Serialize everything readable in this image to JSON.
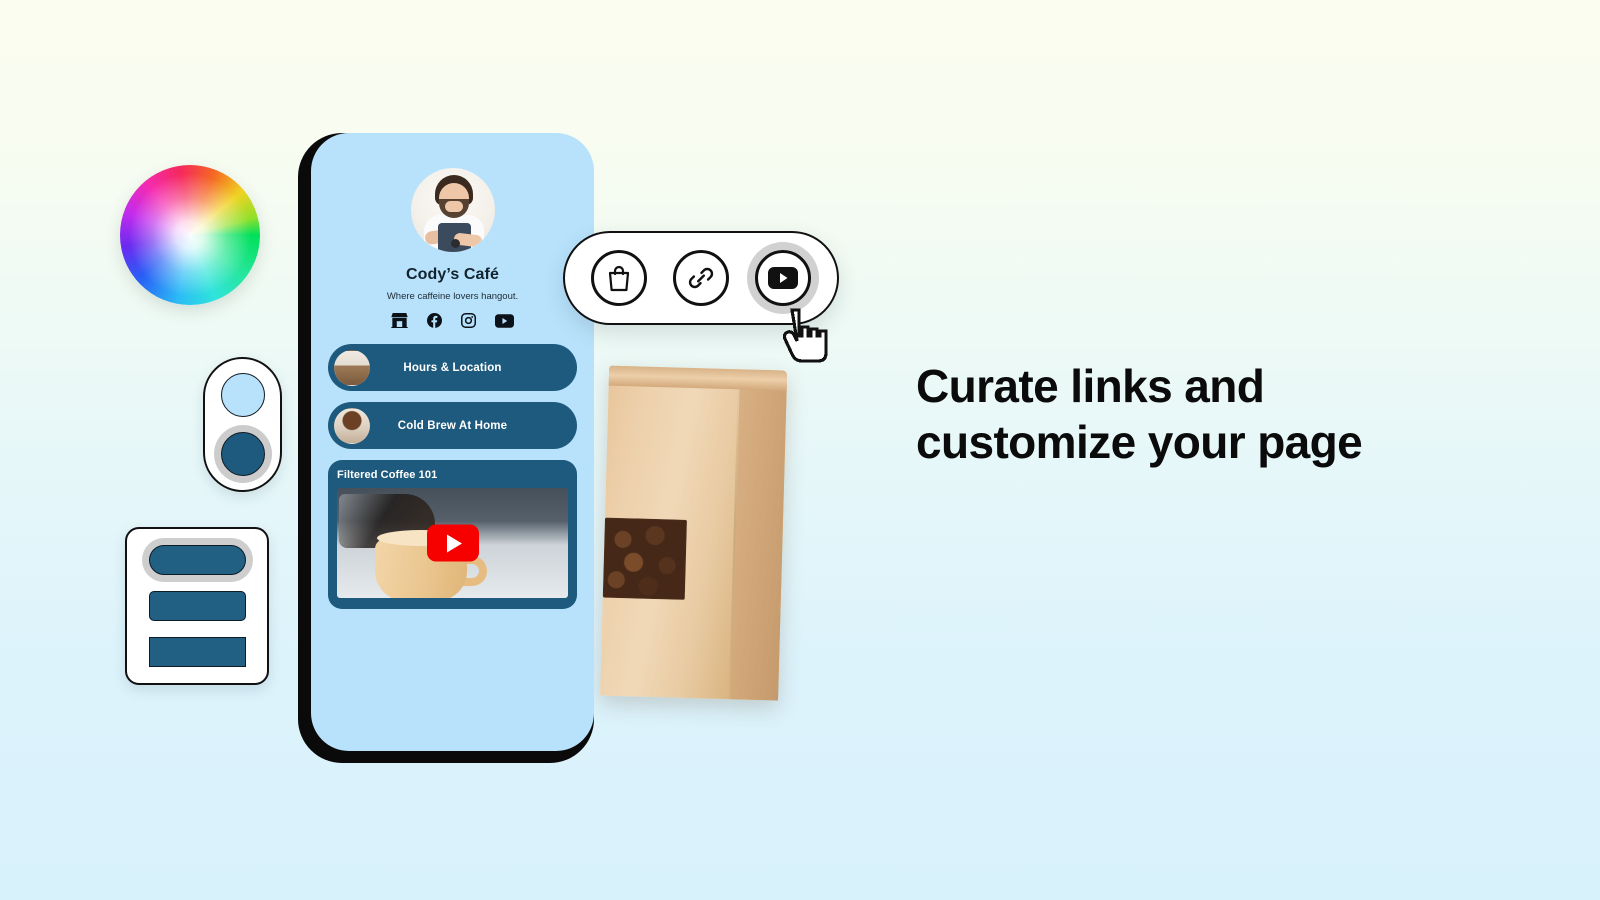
{
  "background": {
    "top_color": "#fbfdf0",
    "mid_color": "#eefaf5",
    "bottom_color": "#d8f2fc"
  },
  "headline": {
    "line1": "Curate links and",
    "line2": "customize your page",
    "color": "#0b0b0b"
  },
  "phone": {
    "screen_color": "#b8e2fb",
    "frame_color": "#0a0a0a",
    "profile": {
      "name": "Cody’s Café",
      "tagline": "Where caffeine lovers hangout.",
      "avatar_alt": "barista-portrait"
    },
    "social_icons": [
      {
        "name": "storefront-icon"
      },
      {
        "name": "facebook-icon"
      },
      {
        "name": "instagram-icon"
      },
      {
        "name": "youtube-icon"
      }
    ],
    "links": [
      {
        "label": "Hours & Location",
        "thumb": "cafe-interior-thumbnail"
      },
      {
        "label": "Cold Brew At Home",
        "thumb": "coffee-brewer-thumbnail"
      }
    ],
    "video_card": {
      "title": "Filtered Coffee 101",
      "thumbnail_alt": "pour-over-coffee-into-mug",
      "play_button": "youtube-play-button",
      "play_color": "#f60000"
    },
    "card_color": "#1e5a7d"
  },
  "icon_toolbar": {
    "icons": [
      {
        "name": "shopping-bag-icon",
        "selected": false
      },
      {
        "name": "link-chain-icon",
        "selected": false
      },
      {
        "name": "youtube-icon",
        "selected": true
      }
    ],
    "cursor": "pointing-hand-cursor"
  },
  "color_wheel": {
    "name": "color-wheel-picker"
  },
  "color_swatch_picker": {
    "swatches": [
      {
        "name": "light-blue-swatch",
        "color": "#b8e2fb",
        "selected": false
      },
      {
        "name": "dark-blue-swatch",
        "color": "#1e5a7d",
        "selected": true
      }
    ]
  },
  "button_shape_picker": {
    "shapes": [
      {
        "name": "pill-shape-option",
        "selected": true
      },
      {
        "name": "rounded-shape-option",
        "selected": false
      },
      {
        "name": "square-shape-option",
        "selected": false
      }
    ],
    "fill_color": "#215f83"
  },
  "coffee_bag": {
    "name": "kraft-coffee-bag",
    "window_alt": "roasted-coffee-beans"
  }
}
